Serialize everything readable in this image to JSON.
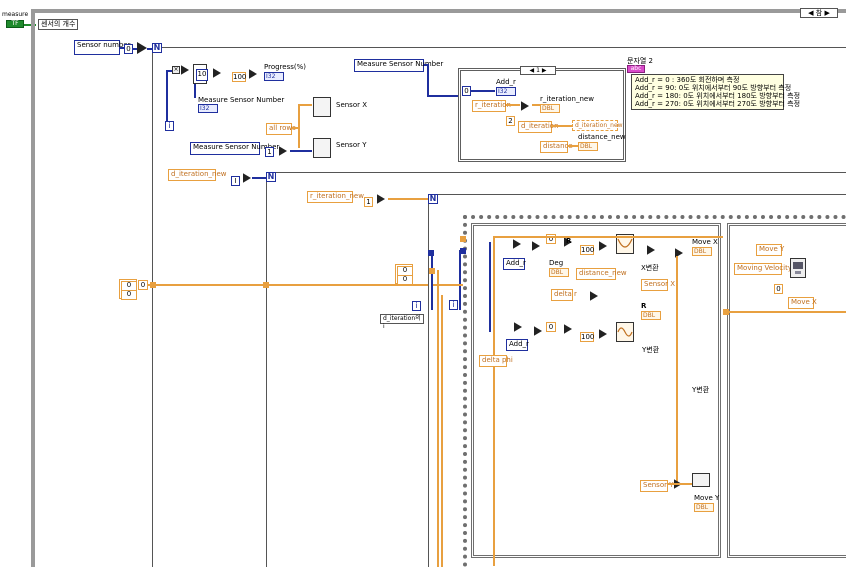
{
  "toolbar": {
    "measure_label": "measure",
    "tf_value": "TF",
    "case_selector": "센서의 개수",
    "case_tab": "참"
  },
  "outer": {
    "sensor_number": "Sensor number",
    "n_label": "N",
    "i_label": "i"
  },
  "progress": {
    "const_10": "10",
    "const_100": "100",
    "progress_label": "Progress(%)",
    "progress_ind": "I32",
    "msn_label": "Measure Sensor Number",
    "msn_ind": "I32"
  },
  "sensors": {
    "all_rows": "all rows",
    "sensor_x": "Sensor X",
    "sensor_y": "Sensor Y",
    "msn_ctrl": "Measure Sensor Number"
  },
  "case_struct": {
    "msn_ctrl": "Measure Sensor Number",
    "selector_value": "1",
    "add_r_label": "Add_r",
    "add_r_ind": "I32",
    "r_iter_ctrl": "r_iteration",
    "r_iter_new_label": "r_iteration_new",
    "r_iter_new_ind": "DBL",
    "d_iter_ctrl": "d_iteration",
    "d_iter_new_ind": "d_iteration_new",
    "dist_new_label": "distance_new",
    "dist_ctrl": "distance",
    "dist_ind": "DBL",
    "const_2": "2",
    "const_0": "0"
  },
  "comment": {
    "title": "문자열 2",
    "tag": "abc",
    "lines": [
      "Add_r = 0 : 360도 회전하며 측정",
      "Add_r = 90: 0도 위치에서부터 90도 방향부터 측정",
      "Add_r = 180: 0도 위치에서부터 180도 방향부터 측정",
      "Add_r = 270: 0도 위치에서부터 270도 방향부터 측정"
    ]
  },
  "loop2": {
    "d_iter_new": "d_iteration_new",
    "n_label": "N",
    "i_label": "i"
  },
  "loop3": {
    "r_iter_new": "r_iteration_new",
    "const_1": "1",
    "n_label": "N",
    "d_iter_count": "d_iteration의 i",
    "i_label": "i"
  },
  "inputs": {
    "arr_0a": "0",
    "arr_0b": "0",
    "arr_0c": "0",
    "inner_0a": "0",
    "inner_0b": "0"
  },
  "inner": {
    "add_r_1": "Add_r",
    "deg_label": "Deg",
    "deg_ind": "DBL",
    "r_label": "R",
    "const_100a": "100",
    "distance_new": "distance_new",
    "delta_r": "delta r",
    "move_x_label": "Move X",
    "move_x_ind": "DBL",
    "sensor_x": "Sensor X",
    "x_conv": "X변환",
    "r_label2": "R",
    "r_ind": "DBL",
    "add_r_2": "Add_r",
    "delta_phi": "delta phi",
    "const_100b": "100",
    "y_conv": "Y변환",
    "sensor_y": "Sensor Y",
    "move_y_label": "Move Y",
    "move_y_ind": "DBL",
    "y_conv2": "Y변환"
  },
  "right": {
    "move_y": "Move Y",
    "moving_velocity": "Moving Velocity",
    "const_0": "0",
    "move_x": "Move X"
  }
}
